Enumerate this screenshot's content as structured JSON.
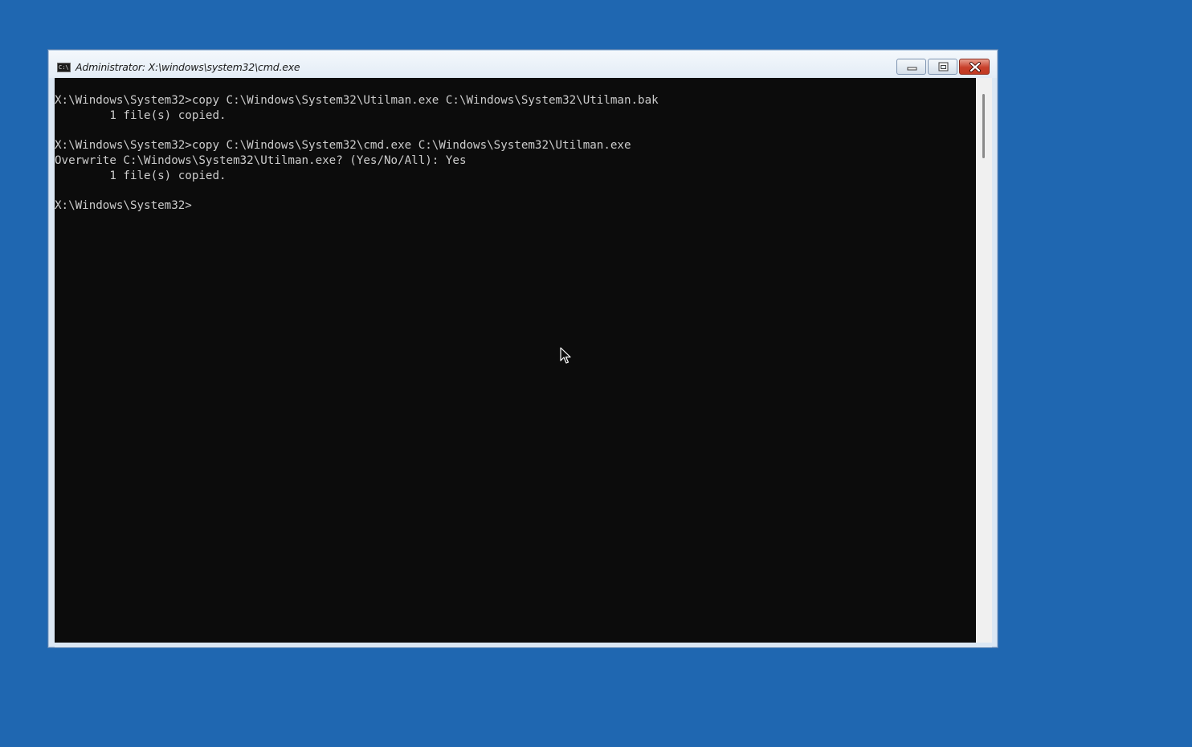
{
  "window": {
    "title": "Administrator: X:\\windows\\system32\\cmd.exe",
    "icon_label": "C:\\",
    "icon": "cmd-console-icon",
    "controls": {
      "minimize_icon": "minimize-icon",
      "maximize_icon": "maximize-icon",
      "close_icon": "close-icon"
    }
  },
  "console": {
    "lines": [
      "X:\\Windows\\System32>copy C:\\Windows\\System32\\Utilman.exe C:\\Windows\\System32\\Utilman.bak",
      "        1 file(s) copied.",
      "",
      "X:\\Windows\\System32>copy C:\\Windows\\System32\\cmd.exe C:\\Windows\\System32\\Utilman.exe",
      "Overwrite C:\\Windows\\System32\\Utilman.exe? (Yes/No/All): Yes",
      "        1 file(s) copied.",
      "",
      "X:\\Windows\\System32>"
    ]
  },
  "colors": {
    "desktop": "#1f67b1",
    "console_background": "#0c0c0c",
    "console_text": "#cccccc",
    "close_button": "#c8402b"
  }
}
